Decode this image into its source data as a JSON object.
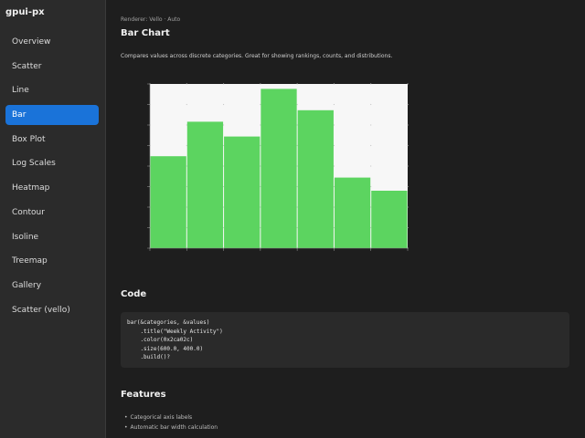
{
  "app": {
    "title": "gpui-px"
  },
  "sidebar": {
    "items": [
      {
        "label": "Overview",
        "active": false
      },
      {
        "label": "Scatter",
        "active": false
      },
      {
        "label": "Line",
        "active": false
      },
      {
        "label": "Bar",
        "active": true
      },
      {
        "label": "Box Plot",
        "active": false
      },
      {
        "label": "Log Scales",
        "active": false
      },
      {
        "label": "Heatmap",
        "active": false
      },
      {
        "label": "Contour",
        "active": false
      },
      {
        "label": "Isoline",
        "active": false
      },
      {
        "label": "Treemap",
        "active": false
      },
      {
        "label": "Gallery",
        "active": false
      },
      {
        "label": "Scatter (vello)",
        "active": false
      }
    ]
  },
  "main": {
    "breadcrumb": "Renderer: Vello · Auto",
    "title": "Bar Chart",
    "description": "Compares values across discrete categories. Great for showing rankings, counts, and distributions.",
    "code_title": "Code",
    "code": "bar(&categories, &values)\n    .title(\"Weekly Activity\")\n    .color(0x2ca02c)\n    .size(600.0, 400.0)\n    .build()?",
    "features_title": "Features",
    "features": [
      "Categorical axis labels",
      "Automatic bar width calculation"
    ]
  },
  "colors": {
    "bar": "#5cd460",
    "plot_background": "#f7f7f7",
    "accent": "#1a73d9"
  },
  "chart_data": {
    "type": "bar",
    "categories": [
      "",
      "",
      "",
      "",
      "",
      "",
      ""
    ],
    "values": [
      56,
      77,
      68,
      97,
      84,
      43,
      35
    ],
    "ylim": [
      0,
      100
    ],
    "grid": true
  }
}
